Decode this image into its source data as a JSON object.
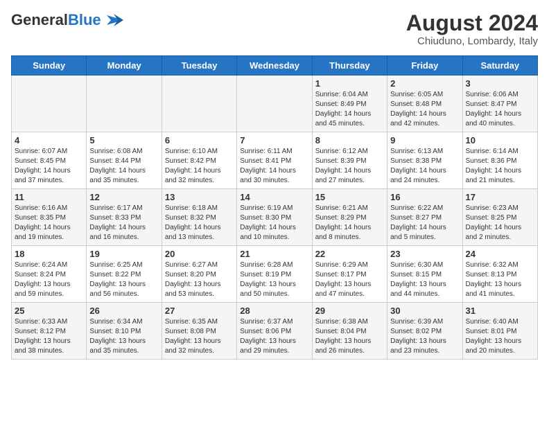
{
  "header": {
    "logo_general": "General",
    "logo_blue": "Blue",
    "title": "August 2024",
    "subtitle": "Chiuduno, Lombardy, Italy"
  },
  "weekdays": [
    "Sunday",
    "Monday",
    "Tuesday",
    "Wednesday",
    "Thursday",
    "Friday",
    "Saturday"
  ],
  "weeks": [
    [
      {
        "day": "",
        "info": ""
      },
      {
        "day": "",
        "info": ""
      },
      {
        "day": "",
        "info": ""
      },
      {
        "day": "",
        "info": ""
      },
      {
        "day": "1",
        "info": "Sunrise: 6:04 AM\nSunset: 8:49 PM\nDaylight: 14 hours\nand 45 minutes."
      },
      {
        "day": "2",
        "info": "Sunrise: 6:05 AM\nSunset: 8:48 PM\nDaylight: 14 hours\nand 42 minutes."
      },
      {
        "day": "3",
        "info": "Sunrise: 6:06 AM\nSunset: 8:47 PM\nDaylight: 14 hours\nand 40 minutes."
      }
    ],
    [
      {
        "day": "4",
        "info": "Sunrise: 6:07 AM\nSunset: 8:45 PM\nDaylight: 14 hours\nand 37 minutes."
      },
      {
        "day": "5",
        "info": "Sunrise: 6:08 AM\nSunset: 8:44 PM\nDaylight: 14 hours\nand 35 minutes."
      },
      {
        "day": "6",
        "info": "Sunrise: 6:10 AM\nSunset: 8:42 PM\nDaylight: 14 hours\nand 32 minutes."
      },
      {
        "day": "7",
        "info": "Sunrise: 6:11 AM\nSunset: 8:41 PM\nDaylight: 14 hours\nand 30 minutes."
      },
      {
        "day": "8",
        "info": "Sunrise: 6:12 AM\nSunset: 8:39 PM\nDaylight: 14 hours\nand 27 minutes."
      },
      {
        "day": "9",
        "info": "Sunrise: 6:13 AM\nSunset: 8:38 PM\nDaylight: 14 hours\nand 24 minutes."
      },
      {
        "day": "10",
        "info": "Sunrise: 6:14 AM\nSunset: 8:36 PM\nDaylight: 14 hours\nand 21 minutes."
      }
    ],
    [
      {
        "day": "11",
        "info": "Sunrise: 6:16 AM\nSunset: 8:35 PM\nDaylight: 14 hours\nand 19 minutes."
      },
      {
        "day": "12",
        "info": "Sunrise: 6:17 AM\nSunset: 8:33 PM\nDaylight: 14 hours\nand 16 minutes."
      },
      {
        "day": "13",
        "info": "Sunrise: 6:18 AM\nSunset: 8:32 PM\nDaylight: 14 hours\nand 13 minutes."
      },
      {
        "day": "14",
        "info": "Sunrise: 6:19 AM\nSunset: 8:30 PM\nDaylight: 14 hours\nand 10 minutes."
      },
      {
        "day": "15",
        "info": "Sunrise: 6:21 AM\nSunset: 8:29 PM\nDaylight: 14 hours\nand 8 minutes."
      },
      {
        "day": "16",
        "info": "Sunrise: 6:22 AM\nSunset: 8:27 PM\nDaylight: 14 hours\nand 5 minutes."
      },
      {
        "day": "17",
        "info": "Sunrise: 6:23 AM\nSunset: 8:25 PM\nDaylight: 14 hours\nand 2 minutes."
      }
    ],
    [
      {
        "day": "18",
        "info": "Sunrise: 6:24 AM\nSunset: 8:24 PM\nDaylight: 13 hours\nand 59 minutes."
      },
      {
        "day": "19",
        "info": "Sunrise: 6:25 AM\nSunset: 8:22 PM\nDaylight: 13 hours\nand 56 minutes."
      },
      {
        "day": "20",
        "info": "Sunrise: 6:27 AM\nSunset: 8:20 PM\nDaylight: 13 hours\nand 53 minutes."
      },
      {
        "day": "21",
        "info": "Sunrise: 6:28 AM\nSunset: 8:19 PM\nDaylight: 13 hours\nand 50 minutes."
      },
      {
        "day": "22",
        "info": "Sunrise: 6:29 AM\nSunset: 8:17 PM\nDaylight: 13 hours\nand 47 minutes."
      },
      {
        "day": "23",
        "info": "Sunrise: 6:30 AM\nSunset: 8:15 PM\nDaylight: 13 hours\nand 44 minutes."
      },
      {
        "day": "24",
        "info": "Sunrise: 6:32 AM\nSunset: 8:13 PM\nDaylight: 13 hours\nand 41 minutes."
      }
    ],
    [
      {
        "day": "25",
        "info": "Sunrise: 6:33 AM\nSunset: 8:12 PM\nDaylight: 13 hours\nand 38 minutes."
      },
      {
        "day": "26",
        "info": "Sunrise: 6:34 AM\nSunset: 8:10 PM\nDaylight: 13 hours\nand 35 minutes."
      },
      {
        "day": "27",
        "info": "Sunrise: 6:35 AM\nSunset: 8:08 PM\nDaylight: 13 hours\nand 32 minutes."
      },
      {
        "day": "28",
        "info": "Sunrise: 6:37 AM\nSunset: 8:06 PM\nDaylight: 13 hours\nand 29 minutes."
      },
      {
        "day": "29",
        "info": "Sunrise: 6:38 AM\nSunset: 8:04 PM\nDaylight: 13 hours\nand 26 minutes."
      },
      {
        "day": "30",
        "info": "Sunrise: 6:39 AM\nSunset: 8:02 PM\nDaylight: 13 hours\nand 23 minutes."
      },
      {
        "day": "31",
        "info": "Sunrise: 6:40 AM\nSunset: 8:01 PM\nDaylight: 13 hours\nand 20 minutes."
      }
    ]
  ]
}
